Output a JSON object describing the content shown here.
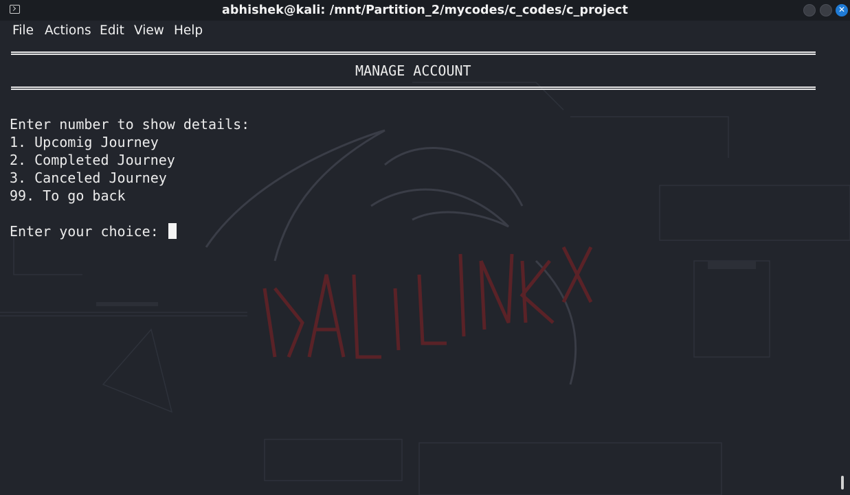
{
  "window": {
    "title": "abhishek@kali: /mnt/Partition_2/mycodes/c_codes/c_project",
    "close_symbol": "✕",
    "icons": [
      "terminal-icon",
      "minimize-icon",
      "maximize-icon",
      "close-icon"
    ]
  },
  "menu": {
    "items": [
      {
        "label": "File"
      },
      {
        "label": "Actions"
      },
      {
        "label": "Edit"
      },
      {
        "label": "View"
      },
      {
        "label": "Help"
      }
    ]
  },
  "terminal": {
    "header": "MANAGE ACCOUNT",
    "prompt_intro": "Enter number to show details:",
    "options": [
      {
        "text": "1. Upcomig Journey"
      },
      {
        "text": "2. Completed Journey"
      },
      {
        "text": "3. Canceled Journey"
      },
      {
        "text": "99. To go back"
      }
    ],
    "input_prompt": "Enter your choice: "
  },
  "colors": {
    "terminal_bg": "#22252c",
    "text": "#ececec",
    "close_button": "#1f7bd6"
  }
}
